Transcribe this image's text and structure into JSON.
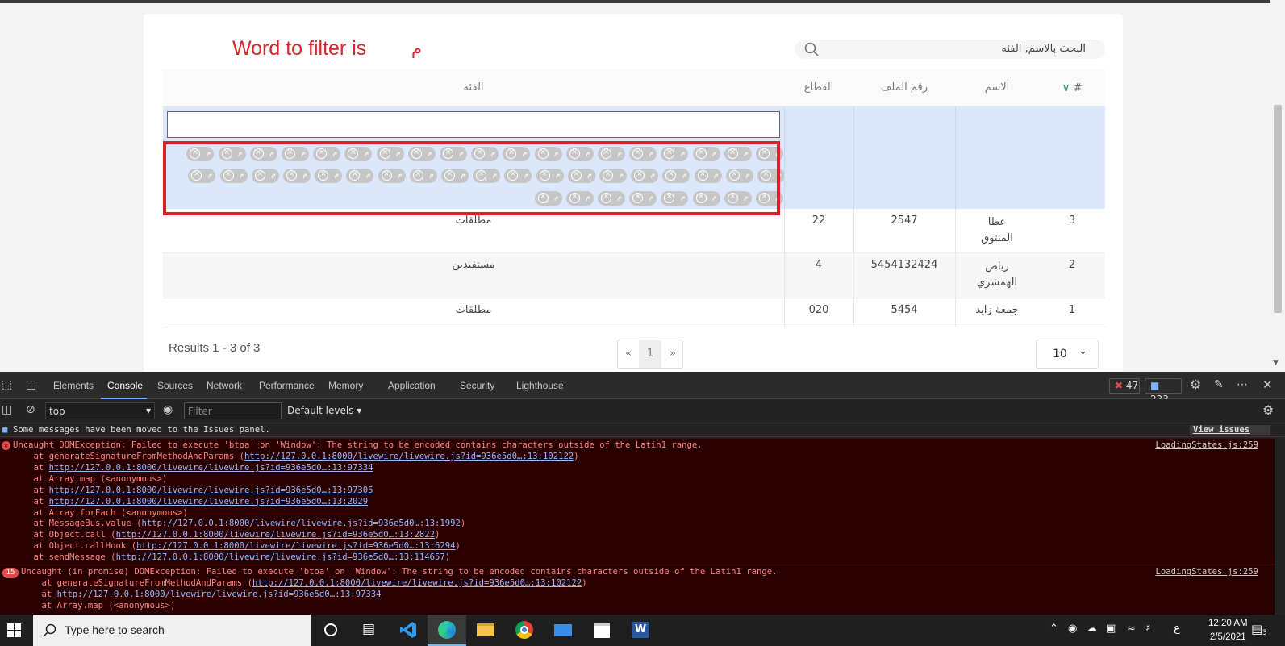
{
  "annotation": {
    "label": "Word to filter is",
    "char": "م"
  },
  "search": {
    "placeholder": "البحث بالاسم, الفئه"
  },
  "table": {
    "headers": {
      "index": "#",
      "name": "الاسم",
      "file_no": "رقم الملف",
      "sector": "القطاع",
      "category": "الفئه"
    },
    "chip_text": "م",
    "chip_count": 46,
    "rows": [
      {
        "index": "3",
        "name": "عطا المنتوق",
        "file_no": "2547",
        "sector": "22",
        "category": "مطلقات"
      },
      {
        "index": "2",
        "name": "رياض الهمشري",
        "file_no": "5454132424",
        "sector": "4",
        "category": "مستفيدين"
      },
      {
        "index": "1",
        "name": "جمعة زايد",
        "file_no": "5454",
        "sector": "020",
        "category": "مطلقات"
      }
    ]
  },
  "footer": {
    "results": "Results 1 - 3 of 3",
    "pager": {
      "prev": "«",
      "current": "1",
      "next": "»"
    },
    "per_page": "10"
  },
  "devtools": {
    "tabs": [
      "Elements",
      "Console",
      "Sources",
      "Network",
      "Performance",
      "Memory",
      "Application",
      "Security",
      "Lighthouse"
    ],
    "active_tab": "Console",
    "error_count": "47",
    "info_count": "223",
    "context": "top",
    "filter_placeholder": "Filter",
    "levels": "Default levels ▾",
    "info_msg": "Some messages have been moved to the Issues panel.",
    "view_issues": "View issues",
    "error1": {
      "title": "Uncaught DOMException: Failed to execute 'btoa' on 'Window': The string to be encoded contains characters outside of the Latin1 range.",
      "source": "LoadingStates.js:259",
      "stack": [
        {
          "prefix": "    at generateSignatureFromMethodAndParams (",
          "link": "http://127.0.0.1:8000/livewire/livewire.js?id=936e5d0…:13:102122",
          "suffix": ")"
        },
        {
          "prefix": "    at ",
          "link": "http://127.0.0.1:8000/livewire/livewire.js?id=936e5d0…:13:97334",
          "suffix": ""
        },
        {
          "prefix": "    at Array.map (<anonymous>)",
          "link": "",
          "suffix": ""
        },
        {
          "prefix": "    at ",
          "link": "http://127.0.0.1:8000/livewire/livewire.js?id=936e5d0…:13:97305",
          "suffix": ""
        },
        {
          "prefix": "    at ",
          "link": "http://127.0.0.1:8000/livewire/livewire.js?id=936e5d0…:13:2029",
          "suffix": ""
        },
        {
          "prefix": "    at Array.forEach (<anonymous>)",
          "link": "",
          "suffix": ""
        },
        {
          "prefix": "    at MessageBus.value (",
          "link": "http://127.0.0.1:8000/livewire/livewire.js?id=936e5d0…:13:1992",
          "suffix": ")"
        },
        {
          "prefix": "    at Object.call (",
          "link": "http://127.0.0.1:8000/livewire/livewire.js?id=936e5d0…:13:2822",
          "suffix": ")"
        },
        {
          "prefix": "    at Object.callHook (",
          "link": "http://127.0.0.1:8000/livewire/livewire.js?id=936e5d0…:13:6294",
          "suffix": ")"
        },
        {
          "prefix": "    at sendMessage (",
          "link": "http://127.0.0.1:8000/livewire/livewire.js?id=936e5d0…:13:114657",
          "suffix": ")"
        }
      ]
    },
    "error2": {
      "count": "15",
      "title": "Uncaught (in promise) DOMException: Failed to execute 'btoa' on 'Window': The string to be encoded contains characters outside of the Latin1 range.",
      "source": "LoadingStates.js:259",
      "stack": [
        {
          "prefix": "    at generateSignatureFromMethodAndParams (",
          "link": "http://127.0.0.1:8000/livewire/livewire.js?id=936e5d0…:13:102122",
          "suffix": ")"
        },
        {
          "prefix": "    at ",
          "link": "http://127.0.0.1:8000/livewire/livewire.js?id=936e5d0…:13:97334",
          "suffix": ""
        },
        {
          "prefix": "    at Array.map (<anonymous>)",
          "link": "",
          "suffix": ""
        }
      ]
    }
  },
  "taskbar": {
    "search_placeholder": "Type here to search",
    "lang": "ع",
    "time": "12:20 AM",
    "date": "2/5/2021",
    "notif_count": "3",
    "accent": "#76b9ed"
  }
}
